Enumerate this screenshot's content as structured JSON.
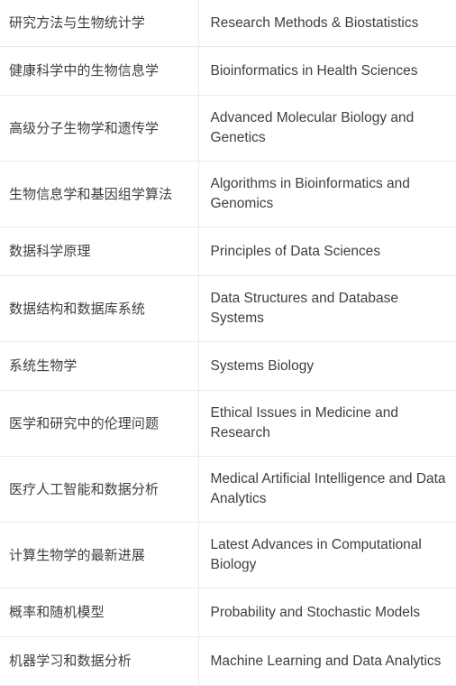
{
  "table": {
    "columns": [
      {
        "key": "zh",
        "header": ""
      },
      {
        "key": "en",
        "header": ""
      }
    ],
    "rows": [
      {
        "zh": "研究方法与生物统计学",
        "en": "Research Methods & Biostatistics"
      },
      {
        "zh": "健康科学中的生物信息学",
        "en": "Bioinformatics in Health Sciences"
      },
      {
        "zh": "高级分子生物学和遗传学",
        "en": "Advanced Molecular Biology and Genetics"
      },
      {
        "zh": "生物信息学和基因组学算法",
        "en": "Algorithms in Bioinformatics and Genomics"
      },
      {
        "zh": "数据科学原理",
        "en": "Principles of Data Sciences"
      },
      {
        "zh": "数据结构和数据库系统",
        "en": "Data Structures and Database Systems"
      },
      {
        "zh": "系统生物学",
        "en": "Systems Biology"
      },
      {
        "zh": "医学和研究中的伦理问题",
        "en": "Ethical Issues in Medicine and Research"
      },
      {
        "zh": "医疗人工智能和数据分析",
        "en": "Medical Artificial Intelligence and Data Analytics"
      },
      {
        "zh": "计算生物学的最新进展",
        "en": "Latest Advances in Computational Biology"
      },
      {
        "zh": "概率和随机模型",
        "en": "Probability and Stochastic Models"
      },
      {
        "zh": "机器学习和数据分析",
        "en": "Machine Learning and Data Analytics"
      }
    ]
  },
  "colors": {
    "text": "#3c4043",
    "divider": "#e9e9ec",
    "background": "#ffffff"
  }
}
